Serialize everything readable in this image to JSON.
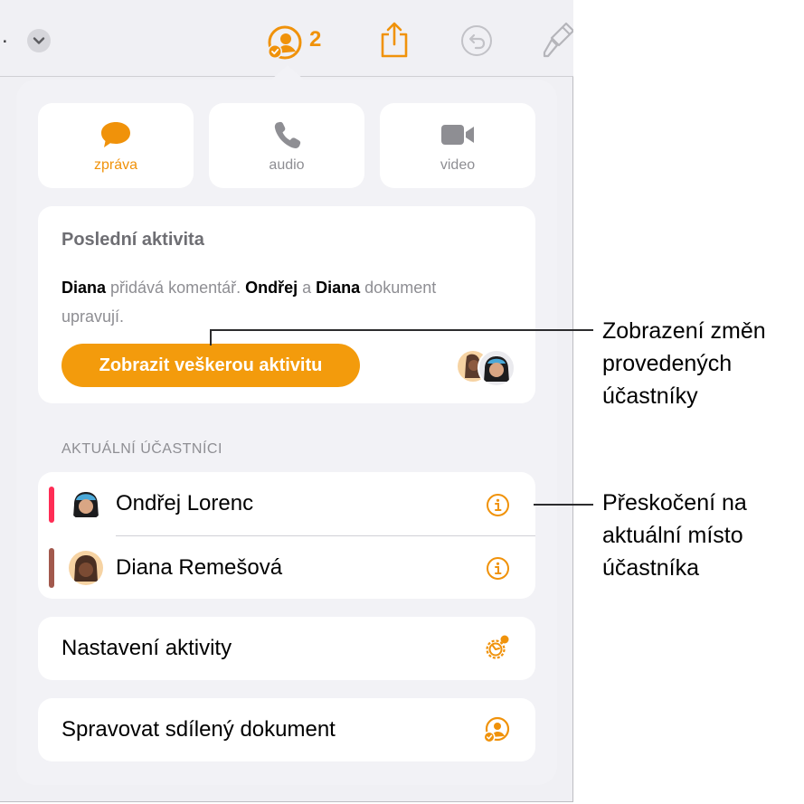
{
  "toolbar": {
    "dots": ".",
    "collab_count": "2",
    "accent": "#f0920a"
  },
  "communicate": [
    {
      "label": "zpráva",
      "icon": "message-bubble-icon",
      "active": true
    },
    {
      "label": "audio",
      "icon": "phone-icon",
      "active": false
    },
    {
      "label": "video",
      "icon": "video-camera-icon",
      "active": false
    }
  ],
  "activity": {
    "title": "Poslední aktivita",
    "name1": "Diana",
    "text1": " přidává komentář. ",
    "name2": "Ondřej",
    "text2": " a ",
    "name3": "Diana",
    "text3": " dokument upravují.",
    "button": "Zobrazit veškerou aktivitu"
  },
  "participants": {
    "header": "AKTUÁLNÍ ÚČASTNÍCI",
    "items": [
      {
        "name": "Ondřej Lorenc",
        "color": "#ff2d55"
      },
      {
        "name": "Diana Remešová",
        "color": "#a2594d"
      }
    ]
  },
  "settings": {
    "activity_settings": "Nastavení aktivity",
    "manage_shared": "Spravovat sdílený dokument"
  },
  "callouts": {
    "first": [
      "Zobrazení změn",
      "provedených",
      "účastníky"
    ],
    "second": [
      "Přeskočení na",
      "aktuální místo",
      "účastníka"
    ]
  }
}
